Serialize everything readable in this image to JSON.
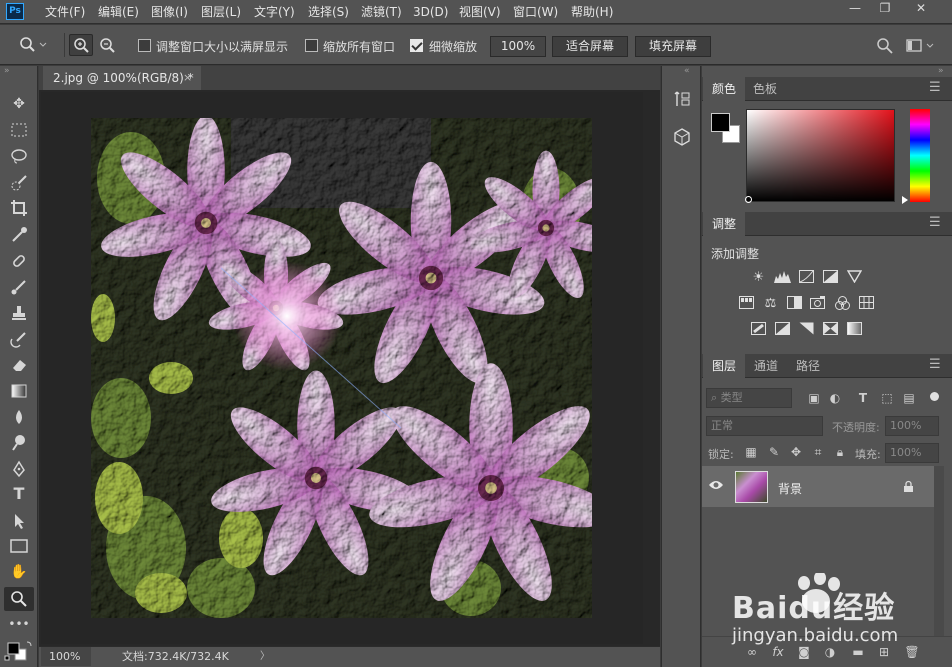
{
  "app": {
    "logo": "Ps"
  },
  "menu": [
    "文件(F)",
    "编辑(E)",
    "图像(I)",
    "图层(L)",
    "文字(Y)",
    "选择(S)",
    "滤镜(T)",
    "3D(D)",
    "视图(V)",
    "窗口(W)",
    "帮助(H)"
  ],
  "window_controls": {
    "minimize": "—",
    "restore": "❐",
    "close": "✕"
  },
  "options": {
    "resize_windows_label": "调整窗口大小以满屏显示",
    "zoom_all_label": "缩放所有窗口",
    "scrubby_zoom_label": "细微缩放",
    "zoom_value": "100%",
    "fit_screen_label": "适合屏幕",
    "fill_screen_label": "填充屏幕",
    "resize_windows_checked": false,
    "zoom_all_checked": false,
    "scrubby_zoom_checked": true
  },
  "tools": [
    "move-tool",
    "marquee-tool",
    "lasso-tool",
    "quick-select-tool",
    "crop-tool",
    "eyedropper-tool",
    "healing-brush-tool",
    "brush-tool",
    "clone-stamp-tool",
    "history-brush-tool",
    "eraser-tool",
    "gradient-tool",
    "blur-tool",
    "dodge-tool",
    "pen-tool",
    "type-tool",
    "path-select-tool",
    "rectangle-tool",
    "hand-tool",
    "zoom-tool",
    "more-tools"
  ],
  "document": {
    "tab_title": "2.jpg @ 100%(RGB/8) *",
    "tab_close": "×"
  },
  "status": {
    "zoom": "100%",
    "doc_size": "文档:732.4K/732.4K",
    "arrow": "〉"
  },
  "color_panel": {
    "tabs": [
      "颜色",
      "色板"
    ],
    "foreground": "#000000",
    "background": "#ffffff",
    "picked_hue": "#e3121b"
  },
  "adjust_panel": {
    "tab": "调整",
    "add_label": "添加调整"
  },
  "layers_panel": {
    "tabs": [
      "图层",
      "通道",
      "路径"
    ],
    "filter_placeholder": "类型",
    "blend_mode": "正常",
    "opacity_label": "不透明度:",
    "opacity_value": "100%",
    "lock_label": "锁定:",
    "fill_label": "填充:",
    "fill_value": "100%",
    "layers": [
      {
        "name": "背景",
        "visible": true,
        "locked": true
      }
    ]
  },
  "watermark": {
    "brand": "Baidu经验",
    "url": "jingyan.baidu.com"
  }
}
